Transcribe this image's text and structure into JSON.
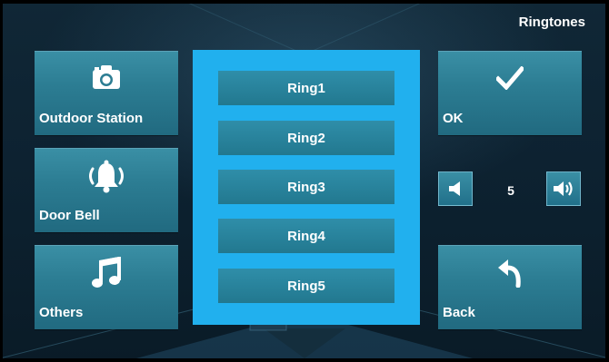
{
  "header": {
    "title": "Ringtones"
  },
  "left_menu": [
    {
      "label": "Outdoor Station",
      "icon": "camera-icon"
    },
    {
      "label": "Door Bell",
      "icon": "bell-ringing-icon"
    },
    {
      "label": "Others",
      "icon": "music-note-icon"
    }
  ],
  "ringtones": [
    "Ring1",
    "Ring2",
    "Ring3",
    "Ring4",
    "Ring5"
  ],
  "actions": {
    "ok_label": "OK",
    "ok_icon": "checkmark-icon",
    "back_label": "Back",
    "back_icon": "back-arrow-icon"
  },
  "volume": {
    "value": "5",
    "down_icon": "volume-down-icon",
    "up_icon": "volume-up-icon"
  },
  "colors": {
    "accent": "#21b0ee",
    "tile": "#2c7d93",
    "background": "#0d2231"
  }
}
